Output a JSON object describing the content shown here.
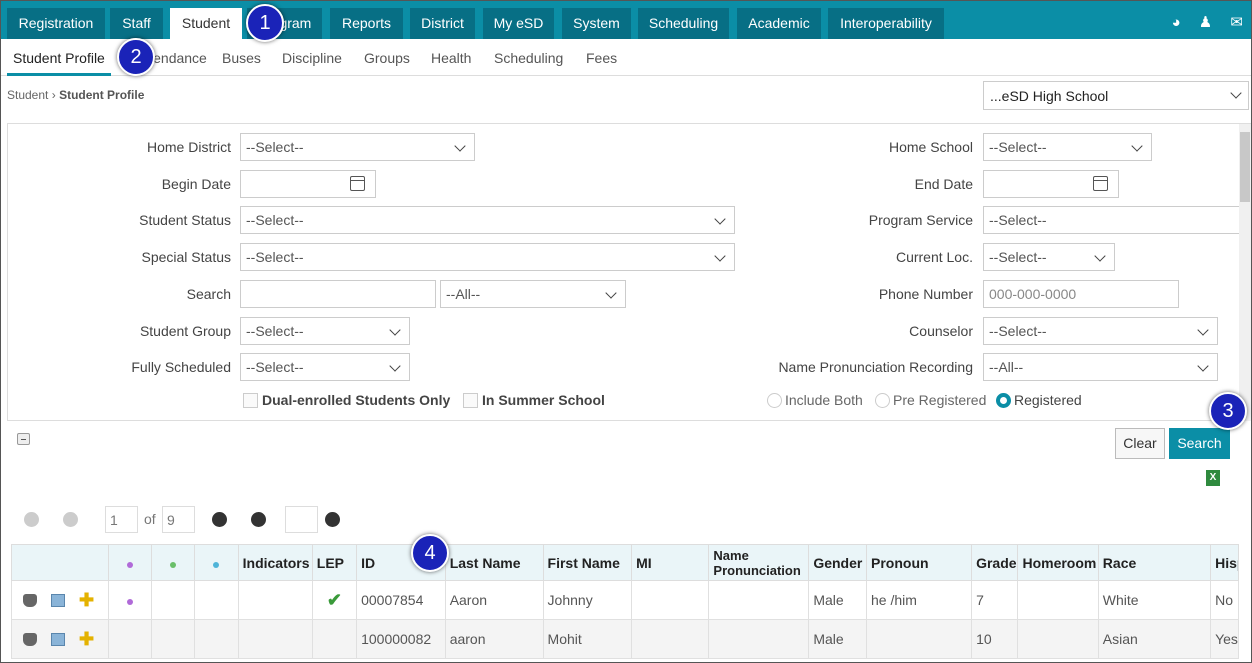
{
  "top_tabs": [
    "Registration",
    "Staff",
    "Student",
    "Program",
    "Reports",
    "District",
    "My eSD",
    "System",
    "Scheduling",
    "Academic",
    "Interoperability"
  ],
  "top_icons": [
    "dashboard-icon",
    "user-icon",
    "mail-icon"
  ],
  "sub_tabs": [
    "Student Profile",
    "Attendance",
    "Buses",
    "Discipline",
    "Groups",
    "Health",
    "Scheduling",
    "Fees"
  ],
  "breadcrumb": {
    "parent": "Student",
    "current": "Student Profile"
  },
  "school_select": "...eSD High School",
  "form": {
    "home_district": {
      "label": "Home District",
      "value": "--Select--"
    },
    "home_school": {
      "label": "Home School",
      "value": "--Select--"
    },
    "begin_date": {
      "label": "Begin Date",
      "value": ""
    },
    "end_date": {
      "label": "End Date",
      "value": ""
    },
    "student_status": {
      "label": "Student Status",
      "value": "--Select--"
    },
    "program_service": {
      "label": "Program Service",
      "value": "--Select--"
    },
    "special_status": {
      "label": "Special Status",
      "value": "--Select--"
    },
    "current_loc": {
      "label": "Current Loc.",
      "value": "--Select--"
    },
    "search": {
      "label": "Search",
      "value": "",
      "scope": "--All--"
    },
    "phone_number": {
      "label": "Phone Number",
      "placeholder": "000-000-0000"
    },
    "student_group": {
      "label": "Student Group",
      "value": "--Select--"
    },
    "counselor": {
      "label": "Counselor",
      "value": "--Select--"
    },
    "fully_scheduled": {
      "label": "Fully Scheduled",
      "value": "--Select--"
    },
    "name_pronunciation": {
      "label": "Name Pronunciation Recording",
      "value": "--All--"
    },
    "dual_enrolled": "Dual-enrolled Students Only",
    "summer_school": "In Summer School",
    "radios": [
      "Include Both",
      "Pre Registered",
      "Registered"
    ],
    "radio_selected": "Registered"
  },
  "buttons": {
    "clear": "Clear",
    "search": "Search"
  },
  "pager": {
    "page": "1",
    "of": "of",
    "total": "9"
  },
  "grid": {
    "columns": [
      "",
      "",
      "",
      "",
      "Indicators",
      "LEP",
      "ID",
      "Last Name",
      "First Name",
      "MI",
      "Name Pronunciation",
      "Gender",
      "Pronoun",
      "Grade",
      "Homeroom",
      "Race",
      "Hisp"
    ],
    "dot_colors": [
      "#b06ad8",
      "#6abf6a",
      "#4fb4d8"
    ],
    "rows": [
      {
        "id": "00007854",
        "last": "Aaron",
        "first": "Johnny",
        "mi": "",
        "gender": "Male",
        "pronoun": "he /him",
        "grade": "7",
        "homeroom": "",
        "race": "White",
        "hisp": "No",
        "lep": true,
        "dot": true
      },
      {
        "id": "100000082",
        "last": "aaron",
        "first": "Mohit",
        "mi": "",
        "gender": "Male",
        "pronoun": "",
        "grade": "10",
        "homeroom": "",
        "race": "Asian",
        "hisp": "Yes",
        "lep": false,
        "dot": false
      }
    ]
  },
  "callouts": [
    "1",
    "2",
    "3",
    "4"
  ]
}
